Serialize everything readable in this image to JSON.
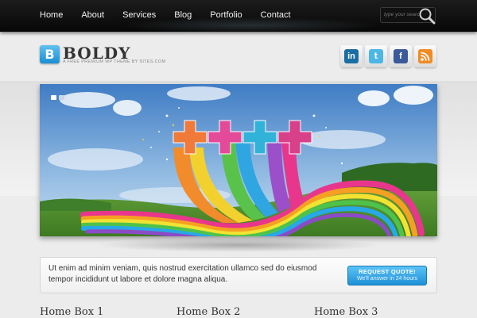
{
  "nav": {
    "items": [
      {
        "label": "Home"
      },
      {
        "label": "About"
      },
      {
        "label": "Services"
      },
      {
        "label": "Blog"
      },
      {
        "label": "Portfolio"
      },
      {
        "label": "Contact"
      }
    ]
  },
  "search": {
    "placeholder": "type your search"
  },
  "logo": {
    "badge": "B",
    "name": "BOLDY",
    "tagline": "A FREE PREMIUM WP THEME BY SITES.COM"
  },
  "social": [
    {
      "icon": "linkedin-icon",
      "glyph": "in",
      "color": "#1a6ea3"
    },
    {
      "icon": "twitter-icon",
      "glyph": "t",
      "color": "#4cb6e6"
    },
    {
      "icon": "facebook-icon",
      "glyph": "f",
      "color": "#3b5a9a"
    },
    {
      "icon": "rss-icon",
      "glyph": "",
      "color": "#f18b23"
    }
  ],
  "cta": {
    "text": "Ut enim ad minim veniam, quis nostrud exercitation ullamco sed do eiusmod tempor incididunt ut labore et dolore magna aliqua.",
    "button_title": "REQUEST QUOTE!",
    "button_sub": "We'll answer in 24 hours"
  },
  "home_boxes": [
    {
      "title": "Home Box 1"
    },
    {
      "title": "Home Box 2"
    },
    {
      "title": "Home Box 3"
    }
  ],
  "colors": {
    "accent": "#1e90d7",
    "topbar": "#0c0c0c",
    "background": "#ececec"
  }
}
